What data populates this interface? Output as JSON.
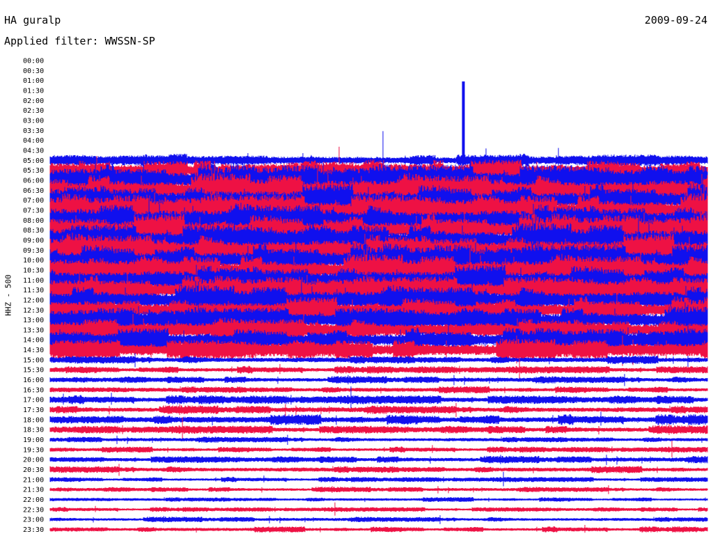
{
  "header": {
    "station": "HA guralp",
    "date": "2009-09-24",
    "filter_label": "Applied filter: WWSSN-SP"
  },
  "chart_data": {
    "type": "line",
    "title": "HA guralp",
    "date": "2009-09-24",
    "subtitle": "Applied filter: WWSSN-SP",
    "ylabel": "HHZ - 500",
    "y_tick_labels": [
      "00:00",
      "00:30",
      "01:00",
      "01:30",
      "02:00",
      "02:30",
      "03:00",
      "03:30",
      "04:00",
      "04:30",
      "05:00",
      "05:30",
      "06:00",
      "06:30",
      "07:00",
      "07:30",
      "08:00",
      "08:30",
      "09:00",
      "09:30",
      "10:00",
      "10:30",
      "11:00",
      "11:30",
      "12:00",
      "12:30",
      "13:00",
      "13:30",
      "14:00",
      "14:30",
      "15:00",
      "15:30",
      "16:00",
      "16:30",
      "17:00",
      "17:30",
      "18:00",
      "18:30",
      "19:00",
      "19:30",
      "20:00",
      "20:30",
      "21:00",
      "21:30",
      "22:00",
      "22:30",
      "23:00",
      "23:30"
    ],
    "series_colors": [
      "#1010ee",
      "#ee1144"
    ],
    "color_order": "alternating by half-hour line, starting blue at 00:00",
    "first_trace_start": "05:00",
    "peak_event": {
      "time": "05:00",
      "row": "05:00"
    },
    "relative_amplitude_by_row": {
      "05:00": 0.55,
      "05:30": 0.9,
      "06:00": 1.4,
      "06:30": 1.4,
      "07:00": 1.4,
      "07:30": 1.4,
      "08:00": 1.4,
      "08:30": 1.4,
      "09:00": 1.4,
      "09:30": 1.4,
      "10:00": 1.4,
      "10:30": 1.3,
      "11:00": 1.3,
      "11:30": 1.2,
      "12:00": 1.2,
      "12:30": 1.1,
      "13:00": 1.1,
      "13:30": 1.0,
      "14:00": 1.0,
      "14:30": 0.9,
      "15:00": 0.35,
      "15:30": 0.32,
      "16:00": 0.3,
      "16:30": 0.3,
      "17:00": 0.38,
      "17:30": 0.35,
      "18:00": 0.45,
      "18:30": 0.35,
      "19:00": 0.25,
      "19:30": 0.25,
      "20:00": 0.3,
      "20:30": 0.3,
      "21:00": 0.22,
      "21:30": 0.22,
      "22:00": 0.2,
      "22:30": 0.2,
      "23:00": 0.22,
      "23:30": 0.25
    }
  }
}
